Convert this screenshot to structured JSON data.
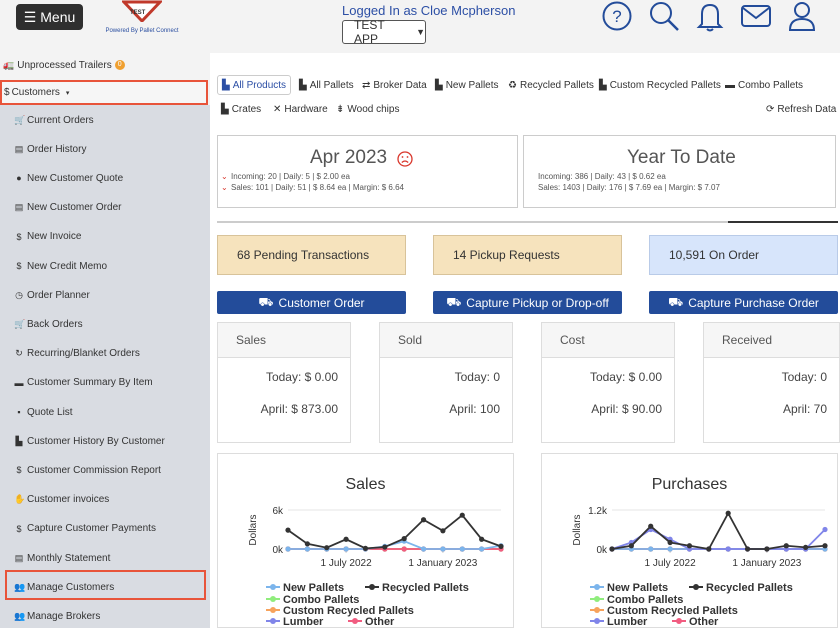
{
  "header": {
    "menu_label": "Menu",
    "logo_word": "PALLET CONNECT",
    "logo_mark": "TEST",
    "logo_caption": "Powered By Pallet Connect",
    "logged_in": "Logged In as Cloe Mcpherson",
    "app_select": "TEST APP",
    "icons": [
      "help-icon",
      "search-icon",
      "bell-icon",
      "mail-icon",
      "user-icon"
    ]
  },
  "sidebar": {
    "unprocessed": "Unprocessed Trailers",
    "unprocessed_count": "0",
    "customers": "Customers",
    "items": [
      {
        "label": "Current Orders",
        "icon": "cart-icon"
      },
      {
        "label": "Order History",
        "icon": "file-icon"
      },
      {
        "label": "New Customer Quote",
        "icon": "quote-icon"
      },
      {
        "label": "New Customer Order",
        "icon": "list-icon"
      },
      {
        "label": "New Invoice",
        "icon": "dollar-icon"
      },
      {
        "label": "New Credit Memo",
        "icon": "dollar-icon"
      },
      {
        "label": "Order Planner",
        "icon": "clock-icon"
      },
      {
        "label": "Back Orders",
        "icon": "cart-icon"
      },
      {
        "label": "Recurring/Blanket Orders",
        "icon": "repeat-icon"
      },
      {
        "label": "Customer Summary By Item",
        "icon": "pallet-icon"
      },
      {
        "label": "Quote List",
        "icon": "comment-icon"
      },
      {
        "label": "Customer History By Customer",
        "icon": "chart-icon"
      },
      {
        "label": "Customer Commission Report",
        "icon": "dollar-icon"
      },
      {
        "label": "Customer invoices",
        "icon": "hand-icon"
      },
      {
        "label": "Capture Customer Payments",
        "icon": "dollar-icon"
      },
      {
        "label": "Monthly Statement",
        "icon": "statement-icon"
      },
      {
        "label": "Manage Customers",
        "icon": "users-icon"
      },
      {
        "label": "Manage Brokers",
        "icon": "users-icon"
      }
    ]
  },
  "tabs": {
    "row1": [
      "All Products",
      "All Pallets",
      "Broker Data",
      "New Pallets",
      "Recycled Pallets",
      "Custom Recycled Pallets",
      "Combo Pallets"
    ],
    "row2": [
      "Crates",
      "Hardware",
      "Wood chips"
    ],
    "refresh": "Refresh Data"
  },
  "month_card": {
    "title": "Apr 2023",
    "incoming": "Incoming: 20 | Daily: 5 | $ 2.00 ea",
    "sales": "Sales: 101 | Daily: 51 | $ 8.64 ea | Margin: $ 6.64"
  },
  "ytd_card": {
    "title": "Year To Date",
    "incoming": "Incoming: 386 | Daily: 43 | $ 0.62 ea",
    "sales": "Sales: 1403 | Daily: 176 | $ 7.69 ea | Margin: $ 7.07"
  },
  "stats": {
    "pending": "68 Pending Transactions",
    "pickup": "14 Pickup Requests",
    "on_order": "10,591 On Order"
  },
  "actions": {
    "customer_order": "Customer Order",
    "capture_pickup": "Capture Pickup or Drop-off",
    "capture_purchase": "Capture Purchase Order"
  },
  "metrics": [
    {
      "title": "Sales",
      "today": "Today: $ 0.00",
      "april": "April: $ 873.00"
    },
    {
      "title": "Sold",
      "today": "Today: 0",
      "april": "April: 100"
    },
    {
      "title": "Cost",
      "today": "Today: $ 0.00",
      "april": "April: $ 90.00"
    },
    {
      "title": "Received",
      "today": "Today: 0",
      "april": "April: 70"
    }
  ],
  "colors": {
    "accent_blue": "#234c9a",
    "highlight_red": "#e8543a",
    "pending_bg": "#f6e3bd",
    "on_order_bg": "#d7e5fb"
  },
  "chart_data": [
    {
      "type": "line",
      "title": "Sales",
      "ylabel": "Dollars",
      "y_ticks": [
        "6k",
        "0k"
      ],
      "x_ticks": [
        "1 July 2022",
        "1 January 2023"
      ],
      "ylim": [
        0,
        6000
      ],
      "legend": [
        "New Pallets",
        "Recycled Pallets",
        "Combo Pallets",
        "Custom Recycled Pallets",
        "Lumber",
        "Other"
      ],
      "series": [
        {
          "name": "Recycled Pallets",
          "color": "#333333",
          "values": [
            2900,
            800,
            200,
            1500,
            100,
            300,
            1600,
            4500,
            2800,
            5200,
            1500,
            400
          ]
        },
        {
          "name": "New Pallets",
          "color": "#7cb5ec",
          "values": [
            0,
            0,
            0,
            0,
            0,
            400,
            1200,
            0,
            0,
            0,
            0,
            500
          ]
        },
        {
          "name": "Other",
          "color": "#f15c80",
          "values": [
            0,
            0,
            0,
            0,
            0,
            0,
            0,
            0,
            0,
            0,
            0,
            0
          ]
        },
        {
          "name": "Custom Recycled Pallets",
          "color": "#f7a35c",
          "values": [
            0,
            0,
            0,
            0,
            0,
            0,
            0,
            0,
            0,
            0,
            0,
            0
          ]
        },
        {
          "name": "Combo Pallets",
          "color": "#90ed7d",
          "values": [
            0,
            0,
            0,
            0,
            0,
            0,
            0,
            0,
            0,
            0,
            0,
            0
          ]
        },
        {
          "name": "Lumber",
          "color": "#8085e9",
          "values": [
            0,
            0,
            0,
            0,
            0,
            0,
            0,
            0,
            0,
            0,
            0,
            0
          ]
        }
      ]
    },
    {
      "type": "line",
      "title": "Purchases",
      "ylabel": "Dollars",
      "y_ticks": [
        "1.2k",
        "0k"
      ],
      "x_ticks": [
        "1 July 2022",
        "1 January 2023"
      ],
      "ylim": [
        0,
        1200
      ],
      "legend": [
        "New Pallets",
        "Recycled Pallets",
        "Combo Pallets",
        "Custom Recycled Pallets",
        "Lumber",
        "Other"
      ],
      "series": [
        {
          "name": "Recycled Pallets",
          "color": "#333333",
          "values": [
            0,
            100,
            700,
            200,
            100,
            0,
            1100,
            0,
            0,
            100,
            50,
            100
          ]
        },
        {
          "name": "Lumber",
          "color": "#8085e9",
          "values": [
            0,
            200,
            600,
            300,
            0,
            0,
            0,
            0,
            0,
            0,
            0,
            600
          ]
        },
        {
          "name": "New Pallets",
          "color": "#7cb5ec",
          "values": [
            0,
            0,
            0,
            0,
            0,
            0,
            0,
            0,
            0,
            0,
            0,
            0
          ]
        },
        {
          "name": "Other",
          "color": "#f15c80",
          "values": [
            0,
            0,
            0,
            0,
            0,
            0,
            0,
            0,
            0,
            0,
            0,
            0
          ]
        },
        {
          "name": "Custom Recycled Pallets",
          "color": "#f7a35c",
          "values": [
            0,
            0,
            0,
            0,
            0,
            0,
            0,
            0,
            0,
            0,
            0,
            0
          ]
        },
        {
          "name": "Combo Pallets",
          "color": "#90ed7d",
          "values": [
            0,
            0,
            0,
            0,
            0,
            0,
            0,
            0,
            0,
            0,
            0,
            0
          ]
        }
      ]
    }
  ]
}
